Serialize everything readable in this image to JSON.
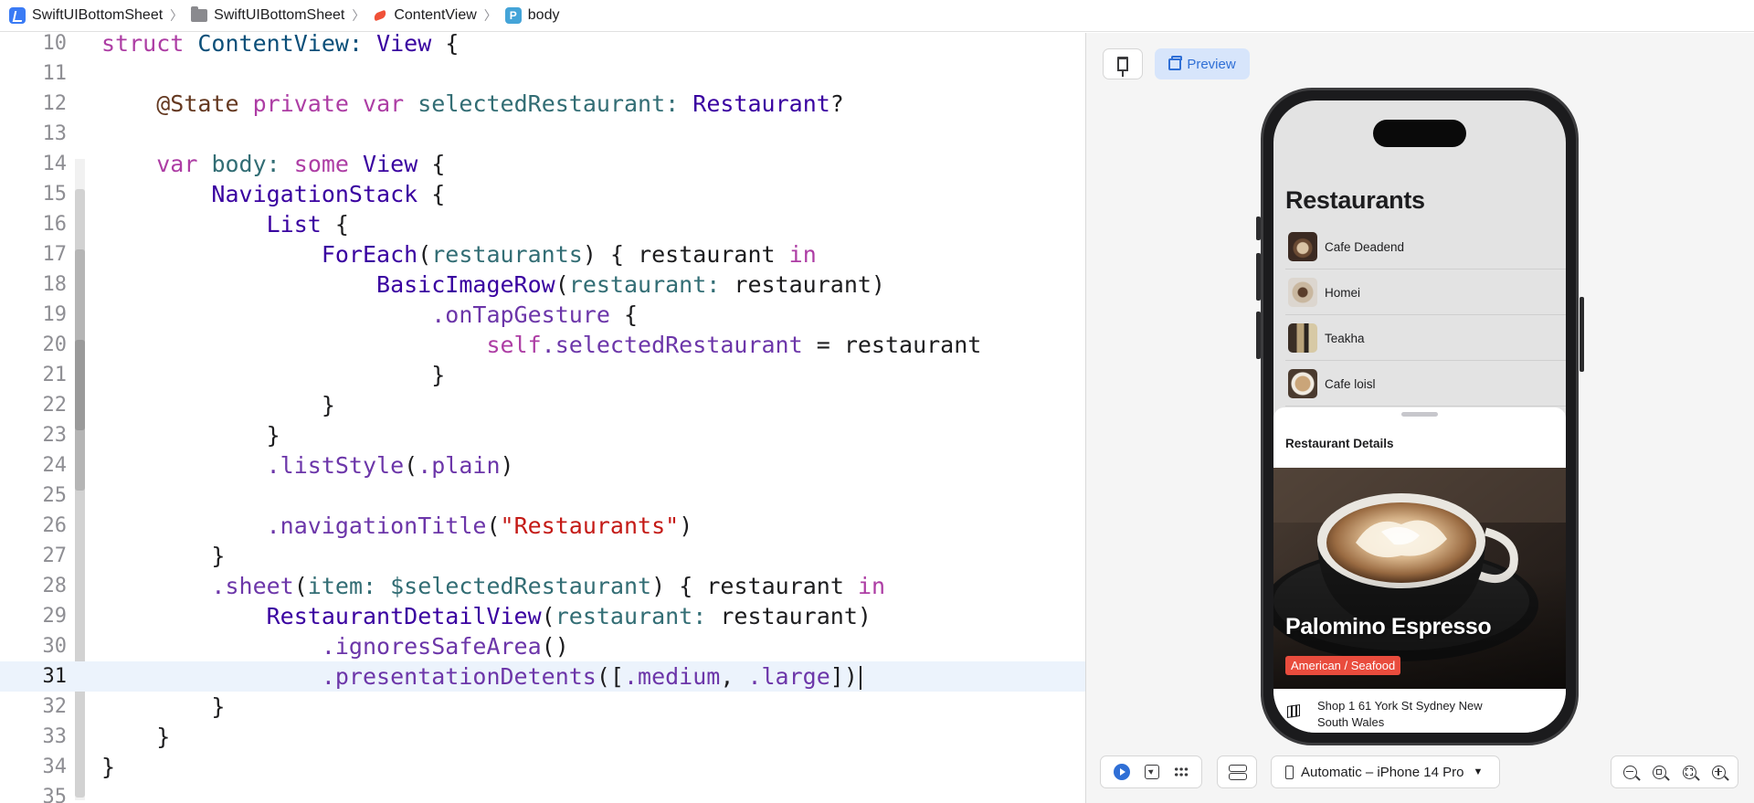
{
  "breadcrumb": {
    "project": "SwiftUIBottomSheet",
    "folder": "SwiftUIBottomSheet",
    "file": "ContentView",
    "symbol": "body",
    "symbol_badge": "P"
  },
  "editor": {
    "current_line": 31,
    "lines": [
      {
        "n": "10",
        "t": "struct ContentView: View {"
      },
      {
        "n": "11",
        "t": ""
      },
      {
        "n": "12",
        "t": "    @State private var selectedRestaurant: Restaurant?"
      },
      {
        "n": "13",
        "t": ""
      },
      {
        "n": "14",
        "t": "    var body: some View {"
      },
      {
        "n": "15",
        "t": "        NavigationStack {"
      },
      {
        "n": "16",
        "t": "            List {"
      },
      {
        "n": "17",
        "t": "                ForEach(restaurants) { restaurant in"
      },
      {
        "n": "18",
        "t": "                    BasicImageRow(restaurant: restaurant)"
      },
      {
        "n": "19",
        "t": "                        .onTapGesture {"
      },
      {
        "n": "20",
        "t": "                            self.selectedRestaurant = restaurant"
      },
      {
        "n": "21",
        "t": "                        }"
      },
      {
        "n": "22",
        "t": "                }"
      },
      {
        "n": "23",
        "t": "            }"
      },
      {
        "n": "24",
        "t": "            .listStyle(.plain)"
      },
      {
        "n": "25",
        "t": ""
      },
      {
        "n": "26",
        "t": "            .navigationTitle(\"Restaurants\")"
      },
      {
        "n": "27",
        "t": "        }"
      },
      {
        "n": "28",
        "t": "        .sheet(item: $selectedRestaurant) { restaurant in"
      },
      {
        "n": "29",
        "t": "            RestaurantDetailView(restaurant: restaurant)"
      },
      {
        "n": "30",
        "t": "                .ignoresSafeArea()"
      },
      {
        "n": "31",
        "t": "                .presentationDetents([.medium, .large])"
      },
      {
        "n": "32",
        "t": "        }"
      },
      {
        "n": "33",
        "t": "    }"
      },
      {
        "n": "34",
        "t": "}"
      },
      {
        "n": "35",
        "t": ""
      }
    ]
  },
  "canvas": {
    "preview_label": "Preview",
    "device_label": "Automatic – iPhone 14 Pro"
  },
  "phone": {
    "nav_title": "Restaurants",
    "restaurants": [
      "Cafe Deadend",
      "Homei",
      "Teakha",
      "Cafe loisl"
    ],
    "sheet": {
      "header": "Restaurant Details",
      "name": "Palomino Espresso",
      "type": "American / Seafood",
      "address": "Shop 1 61 York St Sydney New South Wales"
    }
  },
  "colors": {
    "accent": "#2f6fd6",
    "tag": "#e94c3d",
    "keyword": "#9b2393",
    "string": "#c41a16"
  }
}
